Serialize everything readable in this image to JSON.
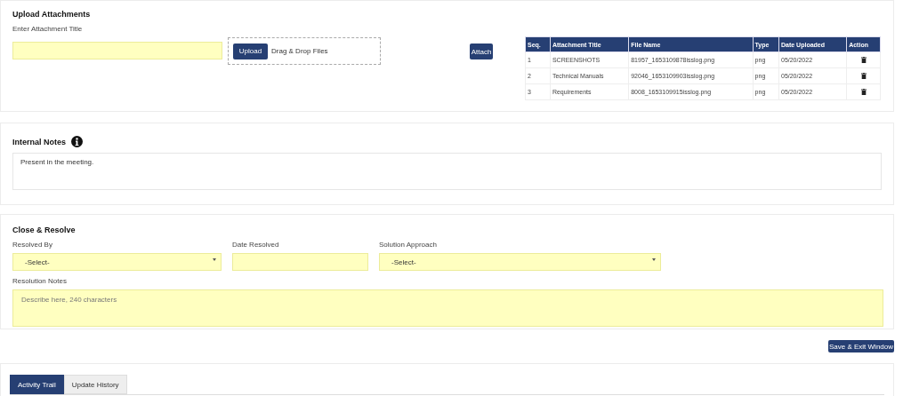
{
  "upload": {
    "title": "Upload Attachments",
    "field_label": "Enter Attachment Title",
    "upload_button": "Upload",
    "drop_hint": "Drag & Drop Files",
    "attach_button": "Attach",
    "table": {
      "columns": [
        "Seq.",
        "Attachment Title",
        "File Name",
        "Type",
        "Date Uploaded",
        "Action"
      ],
      "rows": [
        {
          "seq": "1",
          "title": "SCREENSHOTS",
          "file": "81957_1653109878isslog.png",
          "type": "png",
          "date": "05/20/2022"
        },
        {
          "seq": "2",
          "title": "Technical Manuals",
          "file": "92046_1653109903isslog.png",
          "type": "png",
          "date": "05/20/2022"
        },
        {
          "seq": "3",
          "title": "Requirements",
          "file": "8008_1653109915isslog.png",
          "type": "png",
          "date": "05/20/2022"
        }
      ]
    }
  },
  "notes": {
    "title": "Internal Notes",
    "value": "Present in the meeting."
  },
  "resolve": {
    "title": "Close & Resolve",
    "resolved_by_label": "Resolved By",
    "resolved_by_value": "-Select-",
    "date_label": "Date Resolved",
    "approach_label": "Solution Approach",
    "approach_value": "-Select-",
    "notes_label": "Resolution Notes",
    "notes_placeholder": "Describe here, 240 characters"
  },
  "save_button": "Save & Exit Window",
  "tabs": [
    {
      "label": "Activity Trail",
      "selected": true
    },
    {
      "label": "Update History",
      "selected": false
    }
  ]
}
